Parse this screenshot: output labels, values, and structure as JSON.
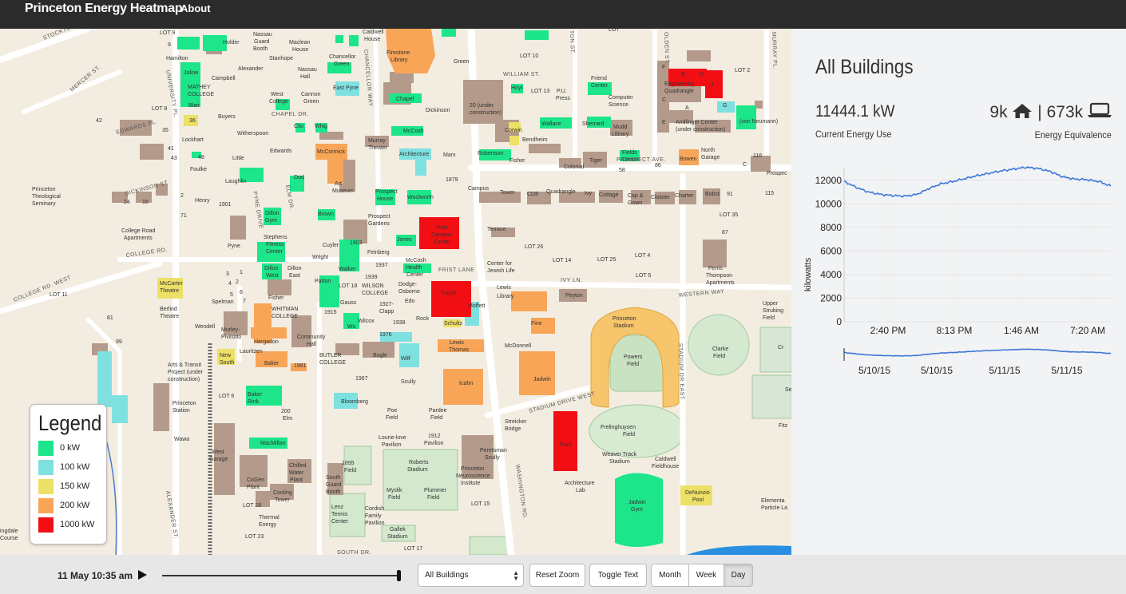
{
  "nav": {
    "brand": "Princeton Energy Heatmap",
    "about": "About"
  },
  "legend": {
    "title": "Legend",
    "items": [
      {
        "label": "0 kW",
        "color": "#1de58a"
      },
      {
        "label": "100 kW",
        "color": "#7fe0e0"
      },
      {
        "label": "150 kW",
        "color": "#ece066"
      },
      {
        "label": "200 kW",
        "color": "#f8a558"
      },
      {
        "label": "1000 kW",
        "color": "#f20f14"
      }
    ]
  },
  "side": {
    "title": "All Buildings",
    "energy_value": "11444.1 kW",
    "energy_caption": "Current Energy Use",
    "equiv_homes": "9k",
    "equiv_sep": "|",
    "equiv_laptops": "673k",
    "equiv_caption": "Energy Equivalence"
  },
  "chart_data": {
    "type": "line",
    "ylabel": "kilowatts",
    "ylim": [
      0,
      13000
    ],
    "y_ticks": [
      "12000",
      "10000",
      "8000",
      "6000",
      "4000",
      "2000",
      "0"
    ],
    "x_ticks": [
      "2:40 PM",
      "8:13 PM",
      "1:46 AM",
      "7:20 AM"
    ],
    "overview_x_ticks": [
      "5/10/15",
      "5/10/15",
      "5/11/15",
      "5/11/15"
    ],
    "series": [
      {
        "values": [
          11900,
          11400,
          11000,
          10800,
          10700,
          10650,
          10800,
          11300,
          11700,
          11900,
          12150,
          12400,
          12600,
          12800,
          12950,
          13100,
          13000,
          12750,
          12300,
          12100,
          12050,
          11900,
          11500
        ]
      }
    ],
    "line_color": "#3c78d8"
  },
  "controls": {
    "time": "11 May 10:35 am",
    "select_value": "All Buildings",
    "reset_zoom": "Reset Zoom",
    "toggle_text": "Toggle Text",
    "month": "Month",
    "week": "Week",
    "day": "Day"
  },
  "map": {
    "labels": [
      "Firestone Library",
      "Chapel",
      "McCosh",
      "Dickinson",
      "Frist Campus Center",
      "Guyot",
      "Jadwin",
      "Fine",
      "Icahn",
      "Lewis Thomas",
      "Wallace",
      "Bowen",
      "Powers Field",
      "Princeton Stadium",
      "Jadwin Gym",
      "Frelinghuysen Field",
      "Weaver Track Stadium",
      "Caldwell Fieldhouse",
      "DeNunzio Pool",
      "Roberts Stadium",
      "Lewis Library",
      "Peyton",
      "Whitman College",
      "Butler College",
      "Wilson College",
      "Mathey College",
      "Baker Rink",
      "MacMillan",
      "West Garage",
      "Dillon Gym",
      "Stephens Fitness Center",
      "Architecture",
      "Robertson",
      "Frick",
      "Green",
      "Woolworth",
      "Brown",
      "Jones",
      "Moffett",
      "Schultz",
      "Corwin",
      "Bendheim",
      "Fisher",
      "Sherrard",
      "Mudd Library",
      "Fields Center",
      "North Garage",
      "Friend Center",
      "Computer Science",
      "Engineering Quadrangle",
      "von Neumann",
      "Andlinger Center (under construction)",
      "Clarke Field",
      "Lourie-love Pavilion",
      "1912 Pavilion",
      "Poe Field",
      "Pardee Field",
      "Myslik Field",
      "Plummer Field",
      "Peretsman Scully",
      "Princeton Neuroscience Institute",
      "Streicker Bridge",
      "Architecture Lab",
      "Lenz Tennis Center",
      "Cordish Family Pavilion",
      "Gallek Stadium",
      "Thermal Energy",
      "Cooling Tower",
      "Chilled Water Plant",
      "CoGen Plant",
      "Princeton Station",
      "Wawa",
      "McCarter Theatre",
      "Berlind Theatre",
      "New South",
      "Hargadon",
      "Lauritzen",
      "Baker",
      "Community Hall",
      "Fisher",
      "Wilcox",
      "Gauss",
      "Walker",
      "Patton",
      "Wright",
      "Cuyler",
      "1903",
      "Dillon West",
      "Dillon East",
      "Feinberg",
      "1937",
      "1939",
      "Dodge-Osborne",
      "Edwards",
      "Laughlin",
      "Henry",
      "1901",
      "Pyne",
      "Little",
      "Foulke",
      "Lockhart",
      "Witherspoon",
      "Blair",
      "Buyers",
      "Joline",
      "Campbell",
      "Hamilton",
      "Holder",
      "Alexander",
      "Stanhope",
      "Maclean House",
      "Nassau Hall",
      "East Pyne",
      "West College",
      "Cannon Green",
      "Clio",
      "Whig",
      "Murray Theater",
      "McCormick",
      "Art Museum",
      "Prospect House",
      "Prospect Gardens",
      "Marx",
      "1879",
      "Campus",
      "Tower",
      "CDE",
      "Quadrangle",
      "Ivy",
      "Cottage",
      "Cap & Gown",
      "Cloister",
      "Charter",
      "Tiger",
      "Colonial",
      "Terrace",
      "Center for Jewish Life",
      "Princeton Theological Seminary",
      "College Road Apartments",
      "Ferris Thompson Apartments",
      "Upper Strubing Field",
      "Elementary Particle Lab",
      "Hoyt",
      "P.U. Press",
      "20 (under construction)",
      "Chancellor Green",
      "Caldwell House",
      "Dod",
      "Nassau Guard Booth",
      "South Guard Booth",
      "Bloomberg",
      "Scully",
      "1967",
      "1976",
      "Wilf",
      "Bogle",
      "1981",
      "Murley-Pivirotto",
      "Arts & Transit Project (under construction)",
      "Spelman",
      "Wendell",
      "Fisher"
    ],
    "roads": [
      "STOCKTON ST.",
      "MERCER ST.",
      "UNIVERSITY PL.",
      "EDWARDS PL.",
      "DICKINSON ST.",
      "COLLEGE RD.",
      "COLLEGE RD. WEST",
      "ALEXANDER ST.",
      "PYNE DRIVE",
      "ELM DR.",
      "CHAPEL DR.",
      "CHANCELLOR WAY",
      "WILLIAM ST.",
      "PROSPECT AVE.",
      "FRIST LANE",
      "IVY LN.",
      "WESTERN WAY",
      "STADIUM DRIVE WEST",
      "STADIUM DR EAST",
      "WASHINGTON RD.",
      "OLDEN ST.",
      "MURRAY PL.",
      "SOUTH DR."
    ],
    "lots": [
      "LOT 9",
      "LOT 8",
      "LOT 10",
      "LOT 13",
      "LOT 2",
      "LOT 26",
      "LOT 14",
      "LOT 25",
      "LOT 4",
      "LOT 5",
      "LOT 35",
      "LOT 11",
      "LOT 18",
      "LOT 6",
      "LOT 28",
      "LOT 23",
      "LOT 17",
      "LOT 15"
    ]
  }
}
